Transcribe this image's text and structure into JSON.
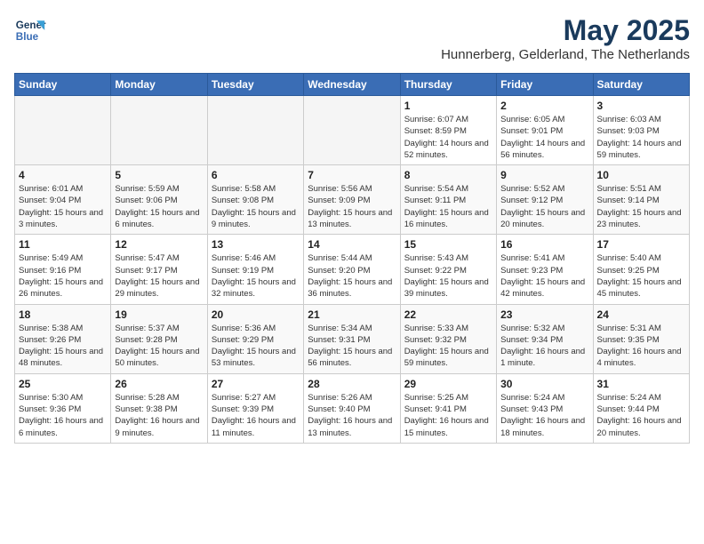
{
  "header": {
    "logo_line1": "General",
    "logo_line2": "Blue",
    "month": "May 2025",
    "location": "Hunnerberg, Gelderland, The Netherlands"
  },
  "weekdays": [
    "Sunday",
    "Monday",
    "Tuesday",
    "Wednesday",
    "Thursday",
    "Friday",
    "Saturday"
  ],
  "weeks": [
    [
      {
        "num": "",
        "empty": true
      },
      {
        "num": "",
        "empty": true
      },
      {
        "num": "",
        "empty": true
      },
      {
        "num": "",
        "empty": true
      },
      {
        "num": "1",
        "rise": "6:07 AM",
        "set": "8:59 PM",
        "daylight": "14 hours and 52 minutes."
      },
      {
        "num": "2",
        "rise": "6:05 AM",
        "set": "9:01 PM",
        "daylight": "14 hours and 56 minutes."
      },
      {
        "num": "3",
        "rise": "6:03 AM",
        "set": "9:03 PM",
        "daylight": "14 hours and 59 minutes."
      }
    ],
    [
      {
        "num": "4",
        "rise": "6:01 AM",
        "set": "9:04 PM",
        "daylight": "15 hours and 3 minutes."
      },
      {
        "num": "5",
        "rise": "5:59 AM",
        "set": "9:06 PM",
        "daylight": "15 hours and 6 minutes."
      },
      {
        "num": "6",
        "rise": "5:58 AM",
        "set": "9:08 PM",
        "daylight": "15 hours and 9 minutes."
      },
      {
        "num": "7",
        "rise": "5:56 AM",
        "set": "9:09 PM",
        "daylight": "15 hours and 13 minutes."
      },
      {
        "num": "8",
        "rise": "5:54 AM",
        "set": "9:11 PM",
        "daylight": "15 hours and 16 minutes."
      },
      {
        "num": "9",
        "rise": "5:52 AM",
        "set": "9:12 PM",
        "daylight": "15 hours and 20 minutes."
      },
      {
        "num": "10",
        "rise": "5:51 AM",
        "set": "9:14 PM",
        "daylight": "15 hours and 23 minutes."
      }
    ],
    [
      {
        "num": "11",
        "rise": "5:49 AM",
        "set": "9:16 PM",
        "daylight": "15 hours and 26 minutes."
      },
      {
        "num": "12",
        "rise": "5:47 AM",
        "set": "9:17 PM",
        "daylight": "15 hours and 29 minutes."
      },
      {
        "num": "13",
        "rise": "5:46 AM",
        "set": "9:19 PM",
        "daylight": "15 hours and 32 minutes."
      },
      {
        "num": "14",
        "rise": "5:44 AM",
        "set": "9:20 PM",
        "daylight": "15 hours and 36 minutes."
      },
      {
        "num": "15",
        "rise": "5:43 AM",
        "set": "9:22 PM",
        "daylight": "15 hours and 39 minutes."
      },
      {
        "num": "16",
        "rise": "5:41 AM",
        "set": "9:23 PM",
        "daylight": "15 hours and 42 minutes."
      },
      {
        "num": "17",
        "rise": "5:40 AM",
        "set": "9:25 PM",
        "daylight": "15 hours and 45 minutes."
      }
    ],
    [
      {
        "num": "18",
        "rise": "5:38 AM",
        "set": "9:26 PM",
        "daylight": "15 hours and 48 minutes."
      },
      {
        "num": "19",
        "rise": "5:37 AM",
        "set": "9:28 PM",
        "daylight": "15 hours and 50 minutes."
      },
      {
        "num": "20",
        "rise": "5:36 AM",
        "set": "9:29 PM",
        "daylight": "15 hours and 53 minutes."
      },
      {
        "num": "21",
        "rise": "5:34 AM",
        "set": "9:31 PM",
        "daylight": "15 hours and 56 minutes."
      },
      {
        "num": "22",
        "rise": "5:33 AM",
        "set": "9:32 PM",
        "daylight": "15 hours and 59 minutes."
      },
      {
        "num": "23",
        "rise": "5:32 AM",
        "set": "9:34 PM",
        "daylight": "16 hours and 1 minute."
      },
      {
        "num": "24",
        "rise": "5:31 AM",
        "set": "9:35 PM",
        "daylight": "16 hours and 4 minutes."
      }
    ],
    [
      {
        "num": "25",
        "rise": "5:30 AM",
        "set": "9:36 PM",
        "daylight": "16 hours and 6 minutes."
      },
      {
        "num": "26",
        "rise": "5:28 AM",
        "set": "9:38 PM",
        "daylight": "16 hours and 9 minutes."
      },
      {
        "num": "27",
        "rise": "5:27 AM",
        "set": "9:39 PM",
        "daylight": "16 hours and 11 minutes."
      },
      {
        "num": "28",
        "rise": "5:26 AM",
        "set": "9:40 PM",
        "daylight": "16 hours and 13 minutes."
      },
      {
        "num": "29",
        "rise": "5:25 AM",
        "set": "9:41 PM",
        "daylight": "16 hours and 15 minutes."
      },
      {
        "num": "30",
        "rise": "5:24 AM",
        "set": "9:43 PM",
        "daylight": "16 hours and 18 minutes."
      },
      {
        "num": "31",
        "rise": "5:24 AM",
        "set": "9:44 PM",
        "daylight": "16 hours and 20 minutes."
      }
    ]
  ],
  "labels": {
    "sunrise": "Sunrise:",
    "sunset": "Sunset:",
    "daylight": "Daylight:"
  }
}
